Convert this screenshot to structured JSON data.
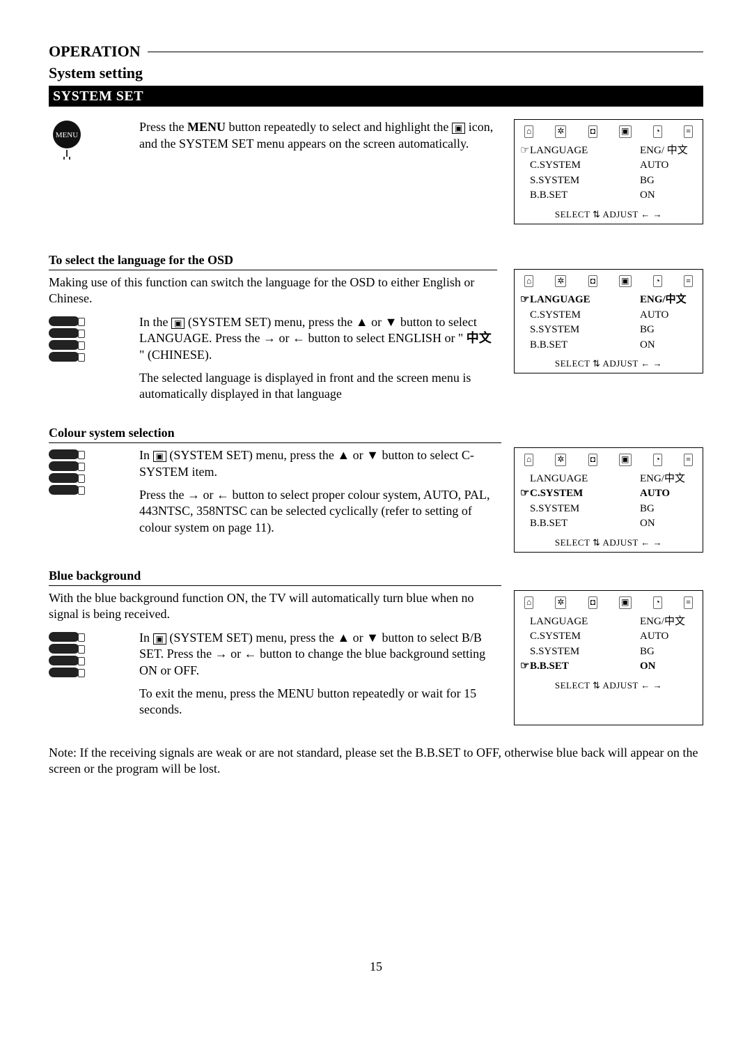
{
  "header": {
    "title": "OPERATION",
    "subtitle": "System setting",
    "section_bar": "SYSTEM SET"
  },
  "intro": {
    "part1": "Press the ",
    "menu_bold": "MENU",
    "part2": " button repeatedly to select and highlight the ",
    "icon_label": "▣",
    "part3": " icon, and the SYSTEM SET menu appears on the screen automatically."
  },
  "osd1": {
    "rows": [
      {
        "label": "LANGUAGE",
        "value": "ENG/ 中文",
        "pointer": true
      },
      {
        "label": "C.SYSTEM",
        "value": "AUTO"
      },
      {
        "label": "S.SYSTEM",
        "value": "BG"
      },
      {
        "label": "B.B.SET",
        "value": "ON"
      }
    ],
    "footer": "SELECT ⇅  ADJUST ← →"
  },
  "lang_section": {
    "title": "To select the language for the OSD",
    "intro": "Making use of this function can switch the language for the OSD to either English or Chinese.",
    "p1_a": "In the ",
    "p1_b": " (SYSTEM SET) menu, press the ▲ or ▼ button to select LANGUAGE. Press the → or ← button to select ENGLISH or \" ",
    "cjk": "中文",
    "p1_c": " \" (CHINESE).",
    "p2": "The selected language is displayed in front and the screen menu is automatically displayed in that language"
  },
  "osd2": {
    "rows": [
      {
        "label": "LANGUAGE",
        "value": "ENG/中文",
        "pointer": true,
        "bold": true
      },
      {
        "label": "C.SYSTEM",
        "value": "AUTO"
      },
      {
        "label": "S.SYSTEM",
        "value": "BG"
      },
      {
        "label": "B.B.SET",
        "value": "ON"
      }
    ],
    "footer": "SELECT ⇅  ADJUST ← →"
  },
  "colour_section": {
    "title": "Colour system selection",
    "p1_a": "In ",
    "p1_b": " (SYSTEM SET) menu, press the ▲ or ▼ button to select C-SYSTEM item.",
    "p2": "Press the → or ← button to select proper colour system, AUTO, PAL, 443NTSC, 358NTSC can be selected cyclically (refer to setting of colour system on page 11)."
  },
  "osd3": {
    "rows": [
      {
        "label": "LANGUAGE",
        "value": "ENG/中文"
      },
      {
        "label": "C.SYSTEM",
        "value": "AUTO",
        "pointer": true,
        "bold": true
      },
      {
        "label": "S.SYSTEM",
        "value": "BG"
      },
      {
        "label": "B.B.SET",
        "value": "ON"
      }
    ],
    "footer": "SELECT ⇅  ADJUST ← →"
  },
  "blue_section": {
    "title": "Blue background",
    "intro": "With the blue background function ON, the TV will automatically turn blue when no signal is being received.",
    "p1_a": "In ",
    "p1_b": " (SYSTEM SET) menu, press the ▲ or ▼ button to select B/B SET. Press the → or ← button to change the blue background setting ON or OFF.",
    "p2": "To exit the menu, press the MENU button repeatedly or wait for 15 seconds."
  },
  "osd4": {
    "rows": [
      {
        "label": "LANGUAGE",
        "value": "ENG/中文"
      },
      {
        "label": "C.SYSTEM",
        "value": "AUTO"
      },
      {
        "label": "S.SYSTEM",
        "value": "BG"
      },
      {
        "label": "B.B.SET",
        "value": "ON",
        "pointer": true,
        "bold": true
      }
    ],
    "footer": "SELECT ⇅  ADJUST ← →"
  },
  "note": "Note: If the receiving signals are weak or are not standard, please set the B.B.SET to OFF, otherwise blue back will appear on the screen or the program will be lost.",
  "page_number": "15",
  "osd_icons": [
    "⌂",
    "✲",
    "◘",
    "▣",
    "◔",
    "≡"
  ]
}
